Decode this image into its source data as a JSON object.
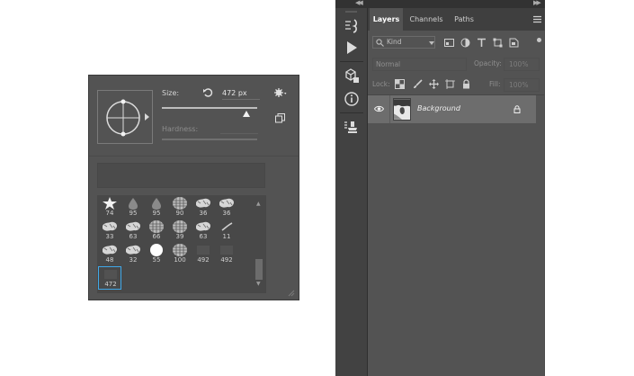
{
  "brush_picker": {
    "size_label": "Size:",
    "size_value": "472 px",
    "size_level_fraction": 0.87,
    "hardness_label": "Hardness:",
    "icons": [
      "reset-icon",
      "gear-icon",
      "new-preset-icon",
      "resize-grip-icon"
    ],
    "presets": [
      {
        "size": "74",
        "shape": "star"
      },
      {
        "size": "95",
        "shape": "drop"
      },
      {
        "size": "95",
        "shape": "drop"
      },
      {
        "size": "90",
        "shape": "texture"
      },
      {
        "size": "36",
        "shape": "splatter"
      },
      {
        "size": "36",
        "shape": "splatter"
      },
      {
        "size": "33",
        "shape": "splatter"
      },
      {
        "size": "63",
        "shape": "splatter"
      },
      {
        "size": "66",
        "shape": "texture"
      },
      {
        "size": "39",
        "shape": "texture"
      },
      {
        "size": "63",
        "shape": "splatter"
      },
      {
        "size": "11",
        "shape": "stroke"
      },
      {
        "size": "48",
        "shape": "splatter"
      },
      {
        "size": "32",
        "shape": "splatter"
      },
      {
        "size": "55",
        "shape": "round"
      },
      {
        "size": "100",
        "shape": "texture"
      },
      {
        "size": "492",
        "shape": "faint"
      },
      {
        "size": "492",
        "shape": "faint"
      },
      {
        "size": "472",
        "shape": "faint"
      }
    ],
    "selected_index": 18
  },
  "dock": {
    "icons": [
      "brush-settings-icon",
      "play-icon",
      "3d-cube-icon",
      "info-icon",
      "clone-source-icon"
    ]
  },
  "layers_panel": {
    "tabs": [
      {
        "label": "Layers",
        "active": true
      },
      {
        "label": "Channels",
        "active": false
      },
      {
        "label": "Paths",
        "active": false
      }
    ],
    "filter_label": "Kind",
    "blend_mode": "Normal",
    "opacity_label": "Opacity:",
    "opacity_value": "100%",
    "lock_label": "Lock:",
    "fill_label": "Fill:",
    "fill_value": "100%",
    "layers": [
      {
        "name": "Background",
        "visible": true,
        "locked": true
      }
    ]
  },
  "colors": {
    "panel_bg": "#535353",
    "dock_bg": "#424242",
    "tab_bar": "#3f3f3f",
    "selected_layer": "#6d6d6d",
    "selection_outline": "#3fa8e8"
  }
}
